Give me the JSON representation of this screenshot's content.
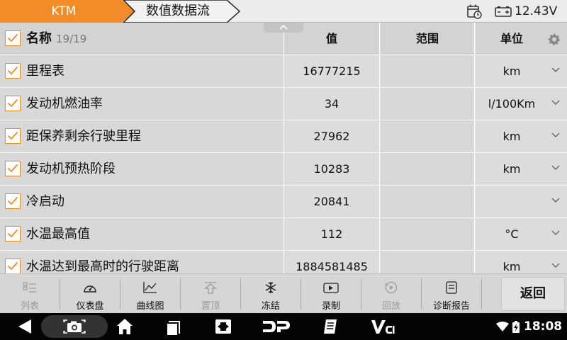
{
  "topbar": {
    "tab_brand": "KTM",
    "tab_current": "数值数据流",
    "voltage": "12.43V",
    "accent_color": "#f28c28"
  },
  "table": {
    "header": {
      "name_label": "名称",
      "count": "19/19",
      "value_label": "值",
      "range_label": "范围",
      "unit_label": "单位"
    },
    "rows": [
      {
        "name": "里程表",
        "value": "16777215",
        "range": "",
        "unit": "km",
        "checked": true
      },
      {
        "name": "发动机燃油率",
        "value": "34",
        "range": "",
        "unit": "l/100Km",
        "checked": true
      },
      {
        "name": "距保养剩余行驶里程",
        "value": "27962",
        "range": "",
        "unit": "km",
        "checked": true
      },
      {
        "name": "发动机预热阶段",
        "value": "10283",
        "range": "",
        "unit": "km",
        "checked": true
      },
      {
        "name": "冷启动",
        "value": "20841",
        "range": "",
        "unit": "",
        "checked": true
      },
      {
        "name": "水温最高值",
        "value": "112",
        "range": "",
        "unit": "°C",
        "checked": true
      },
      {
        "name": "水温达到最高时的行驶距离",
        "value": "1884581485",
        "range": "",
        "unit": "km",
        "checked": true
      }
    ]
  },
  "toolbar": {
    "items": [
      {
        "label": "列表",
        "icon": "list-icon",
        "enabled": false
      },
      {
        "label": "仪表盘",
        "icon": "gauge-icon",
        "enabled": true
      },
      {
        "label": "曲线图",
        "icon": "line-chart-icon",
        "enabled": true
      },
      {
        "label": "置顶",
        "icon": "pin-top-icon",
        "enabled": false
      },
      {
        "label": "冻结",
        "icon": "snowflake-icon",
        "enabled": true
      },
      {
        "label": "录制",
        "icon": "record-icon",
        "enabled": true
      },
      {
        "label": "回放",
        "icon": "playback-icon",
        "enabled": false
      },
      {
        "label": "诊断报告",
        "icon": "report-icon",
        "enabled": true
      }
    ],
    "back_label": "返回"
  },
  "navbar": {
    "clock": "18:08"
  }
}
